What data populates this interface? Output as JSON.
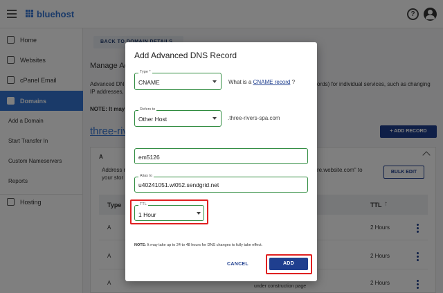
{
  "topbar": {
    "logo_text": "bluehost"
  },
  "sidebar": {
    "items": [
      {
        "label": "Home",
        "icon": "home-icon"
      },
      {
        "label": "Websites",
        "icon": "grid-icon"
      },
      {
        "label": "cPanel Email",
        "icon": "mail-icon"
      },
      {
        "label": "Domains",
        "icon": "folder-icon"
      },
      {
        "label": "Add a Domain"
      },
      {
        "label": "Start Transfer In"
      },
      {
        "label": "Custom Nameservers"
      },
      {
        "label": "Reports"
      },
      {
        "label": "Hosting",
        "icon": "server-icon"
      }
    ]
  },
  "main": {
    "back_label": "BACK TO DOMAIN DETAILS",
    "heading": "Manage Ac",
    "para_line1": "Advanced DN",
    "para_line2": "IP addresses,",
    "para_right": "ords) for individual services, such as changing",
    "note_label": "NOTE: It may",
    "domain_link": "three-rive",
    "add_record_label": "+ ADD RECORD",
    "card": {
      "section_label": "A",
      "address_text": "Address r",
      "address_text2": "your stor",
      "right_text": "re.website.com\" to",
      "bulk_edit_label": "BULK EDIT",
      "columns": {
        "type": "Type",
        "ttl": "TTL"
      },
      "rows": [
        {
          "type": "A",
          "ttl": "2 Hours"
        },
        {
          "type": "A",
          "ttl": "2 Hours"
        },
        {
          "type": "A",
          "ttl": "2 Hours"
        }
      ],
      "under_construction": "under construction page"
    }
  },
  "modal": {
    "title": "Add Advanced DNS Record",
    "type_field": {
      "label": "Type *",
      "value": "CNAME"
    },
    "cname_help": {
      "prefix": "What is a ",
      "link": "CNAME record",
      "suffix": " ?"
    },
    "refers_field": {
      "label": "Refers to",
      "value": "Other Host"
    },
    "host_suffix": ".three-rivers-spa.com",
    "host_value": "em5126",
    "alias_field": {
      "label": "Alias to",
      "value": "u40241051.wl052.sendgrid.net"
    },
    "ttl_field": {
      "label": "TTL",
      "value": "1 Hour"
    },
    "note_bold": "NOTE:",
    "note_text": " It may take up to 24 to 48 hours for DNS changes to fully take effect.",
    "cancel_label": "CANCEL",
    "add_label": "ADD"
  },
  "colors": {
    "brand_blue": "#3575d3",
    "primary_button": "#1f3f8f",
    "field_border_green": "#2e8b3e",
    "highlight_red": "#e02020"
  }
}
